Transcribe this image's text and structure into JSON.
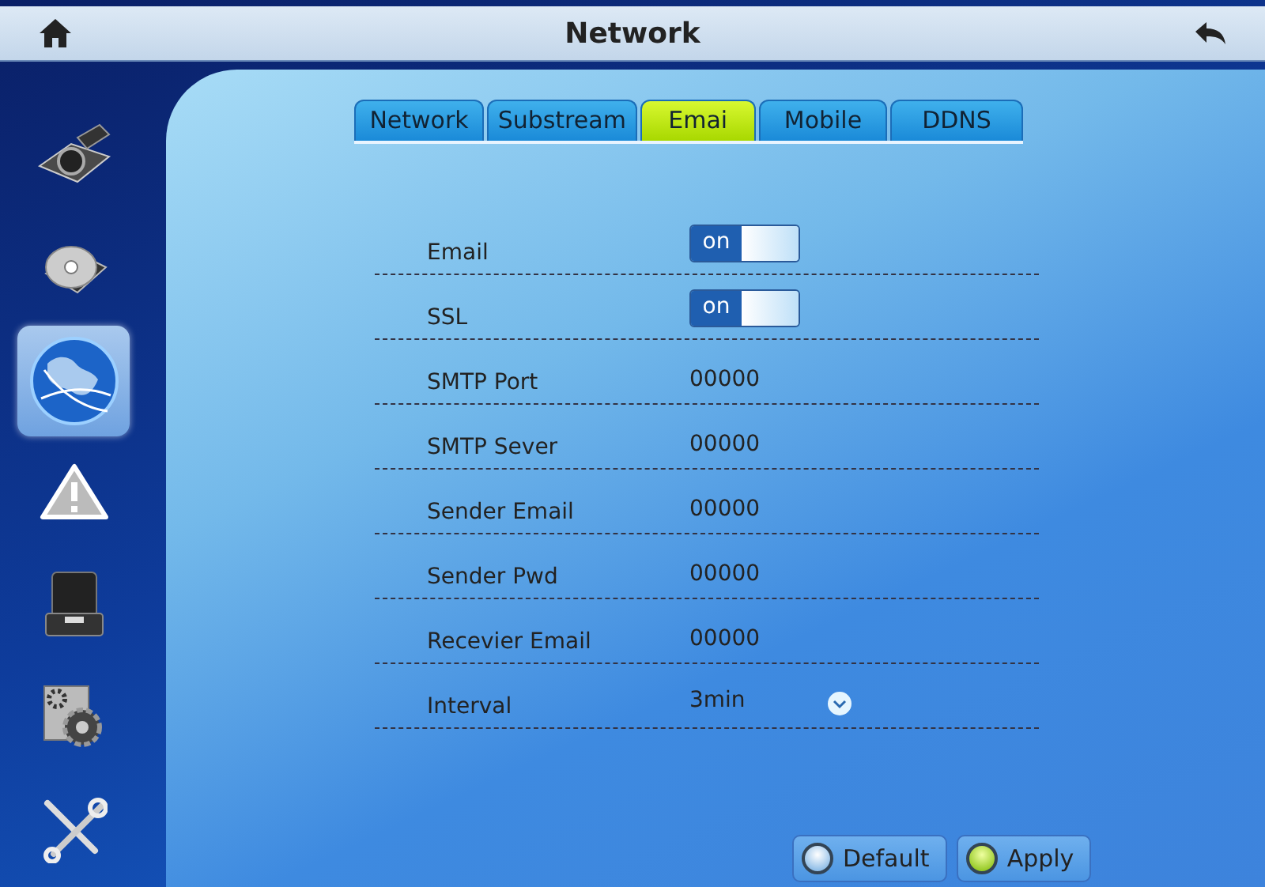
{
  "header": {
    "title": "Network"
  },
  "sidebar": {
    "items": [
      {
        "kind": "camera",
        "selected": false
      },
      {
        "kind": "disk",
        "selected": false
      },
      {
        "kind": "globe",
        "selected": true
      },
      {
        "kind": "warning",
        "selected": false
      },
      {
        "kind": "device",
        "selected": false
      },
      {
        "kind": "gears",
        "selected": false
      },
      {
        "kind": "tools",
        "selected": false
      }
    ]
  },
  "tabs": [
    {
      "label": "Network",
      "selected": false
    },
    {
      "label": "Substream",
      "selected": false
    },
    {
      "label": "Emai",
      "selected": true
    },
    {
      "label": "Mobile",
      "selected": false
    },
    {
      "label": "DDNS",
      "selected": false
    }
  ],
  "rows": [
    {
      "kind": "toggle",
      "label": "Email",
      "value": "on",
      "on": true
    },
    {
      "kind": "toggle",
      "label": "SSL",
      "value": "on",
      "on": true
    },
    {
      "kind": "text",
      "label": "SMTP Port",
      "value": "00000"
    },
    {
      "kind": "text",
      "label": "SMTP Sever",
      "value": "00000"
    },
    {
      "kind": "text",
      "label": "Sender Email",
      "value": "00000"
    },
    {
      "kind": "text",
      "label": "Sender Pwd",
      "value": "00000"
    },
    {
      "kind": "text",
      "label": "Recevier Email",
      "value": "00000"
    },
    {
      "kind": "dropdown",
      "label": "Interval",
      "value": "3min"
    }
  ],
  "buttons": [
    {
      "label": "Default",
      "kind": "default"
    },
    {
      "label": "Apply",
      "kind": "apply"
    }
  ]
}
